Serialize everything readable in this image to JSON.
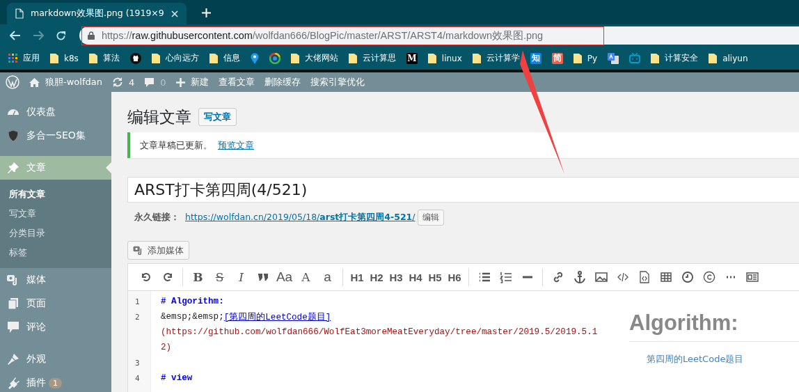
{
  "browser": {
    "tab": {
      "title": "markdown效果图.png (1919×9"
    },
    "nav": {
      "back_disabled": false,
      "forward_disabled": true
    },
    "url": {
      "scheme": "https://",
      "host": "raw.githubusercontent.com",
      "path": "/wolfdan666/BlogPic/master/ARST/ARST4/markdown效果图.png"
    },
    "bookmarks": [
      {
        "kind": "icon",
        "label": "应用"
      },
      {
        "kind": "folder",
        "label": "k8s"
      },
      {
        "kind": "folder",
        "label": "算法"
      },
      {
        "kind": "icon"
      },
      {
        "kind": "folder",
        "label": "心向远方"
      },
      {
        "kind": "folder",
        "label": "信息"
      },
      {
        "kind": "icon"
      },
      {
        "kind": "icon"
      },
      {
        "kind": "folder",
        "label": "大佬网站"
      },
      {
        "kind": "folder",
        "label": "云计算思"
      },
      {
        "kind": "badge",
        "badge": "M",
        "color": "#000000"
      },
      {
        "kind": "folder",
        "label": "linux"
      },
      {
        "kind": "folder",
        "label": "云计算学"
      },
      {
        "kind": "badge",
        "badge": "知",
        "color": "#0a84e6"
      },
      {
        "kind": "badge",
        "badge": "简",
        "color": "#e8614d"
      },
      {
        "kind": "folder",
        "label": "Py"
      },
      {
        "kind": "icon"
      },
      {
        "kind": "icon"
      },
      {
        "kind": "folder",
        "label": "计算安全"
      },
      {
        "kind": "folder",
        "label": "aliyun"
      }
    ]
  },
  "admin_bar": {
    "site": "狼胆-wolfdan",
    "updates": "4",
    "comments": "0",
    "new": "新建",
    "links": [
      "查看文章",
      "删除缓存",
      "搜索引擎优化"
    ]
  },
  "sidebar": {
    "groups": [
      {
        "items": [
          {
            "label": "仪表盘",
            "selected": false
          },
          {
            "label": "多合一SEO集",
            "selected": false
          }
        ]
      },
      {
        "items": [
          {
            "label": "文章",
            "selected": true,
            "children": [
              {
                "label": "所有文章",
                "selected": true
              },
              {
                "label": "写文章",
                "selected": false
              },
              {
                "label": "分类目录",
                "selected": false
              },
              {
                "label": "标签",
                "selected": false
              }
            ]
          },
          {
            "label": "媒体",
            "selected": false
          },
          {
            "label": "页面",
            "selected": false
          },
          {
            "label": "评论",
            "selected": false
          }
        ]
      },
      {
        "items": [
          {
            "label": "外观",
            "selected": false
          },
          {
            "label": "插件",
            "selected": false,
            "badge": "1"
          }
        ]
      }
    ]
  },
  "page": {
    "title": "编辑文章",
    "add_new": "写文章",
    "notice": {
      "text": "文章草稿已更新。",
      "link": "预览文章"
    },
    "post_title": "ARST打卡第四周(4/521)",
    "permalink": {
      "label": "永久链接：",
      "url": "https://wolfdan.cn/2019/05/18/",
      "slug": "arst打卡第四周4-521",
      "end": "/",
      "edit": "编辑"
    },
    "add_media": "添加媒体",
    "toolbar": {
      "labels": [
        "B",
        "S",
        "I",
        "Aa",
        "A",
        "a",
        "H1",
        "H2",
        "H3",
        "H4",
        "H5",
        "H6"
      ]
    },
    "code_lines": [
      {
        "number": "1",
        "rows": [
          [
            {
              "kind": "heading",
              "text": "# Algorithm:"
            }
          ]
        ]
      },
      {
        "number": "2",
        "rows": [
          [
            {
              "kind": "plain",
              "text": "&emsp;&emsp;"
            },
            {
              "kind": "link",
              "text": "[第四周的LeetCode题目]"
            }
          ],
          [
            {
              "kind": "url",
              "text": "(https://github.com/wolfdan666/WolfEat3moreMeatEveryday/tree/master/2019.5/2019.5.1"
            }
          ],
          [
            {
              "kind": "url",
              "text": "2)"
            }
          ]
        ]
      },
      {
        "number": "3",
        "rows": [
          []
        ]
      },
      {
        "number": "4",
        "rows": [
          [
            {
              "kind": "heading",
              "text": "# view"
            }
          ]
        ]
      }
    ],
    "preview": {
      "heading": "Algorithm:",
      "link": "第四周的LeetCode题目"
    }
  }
}
